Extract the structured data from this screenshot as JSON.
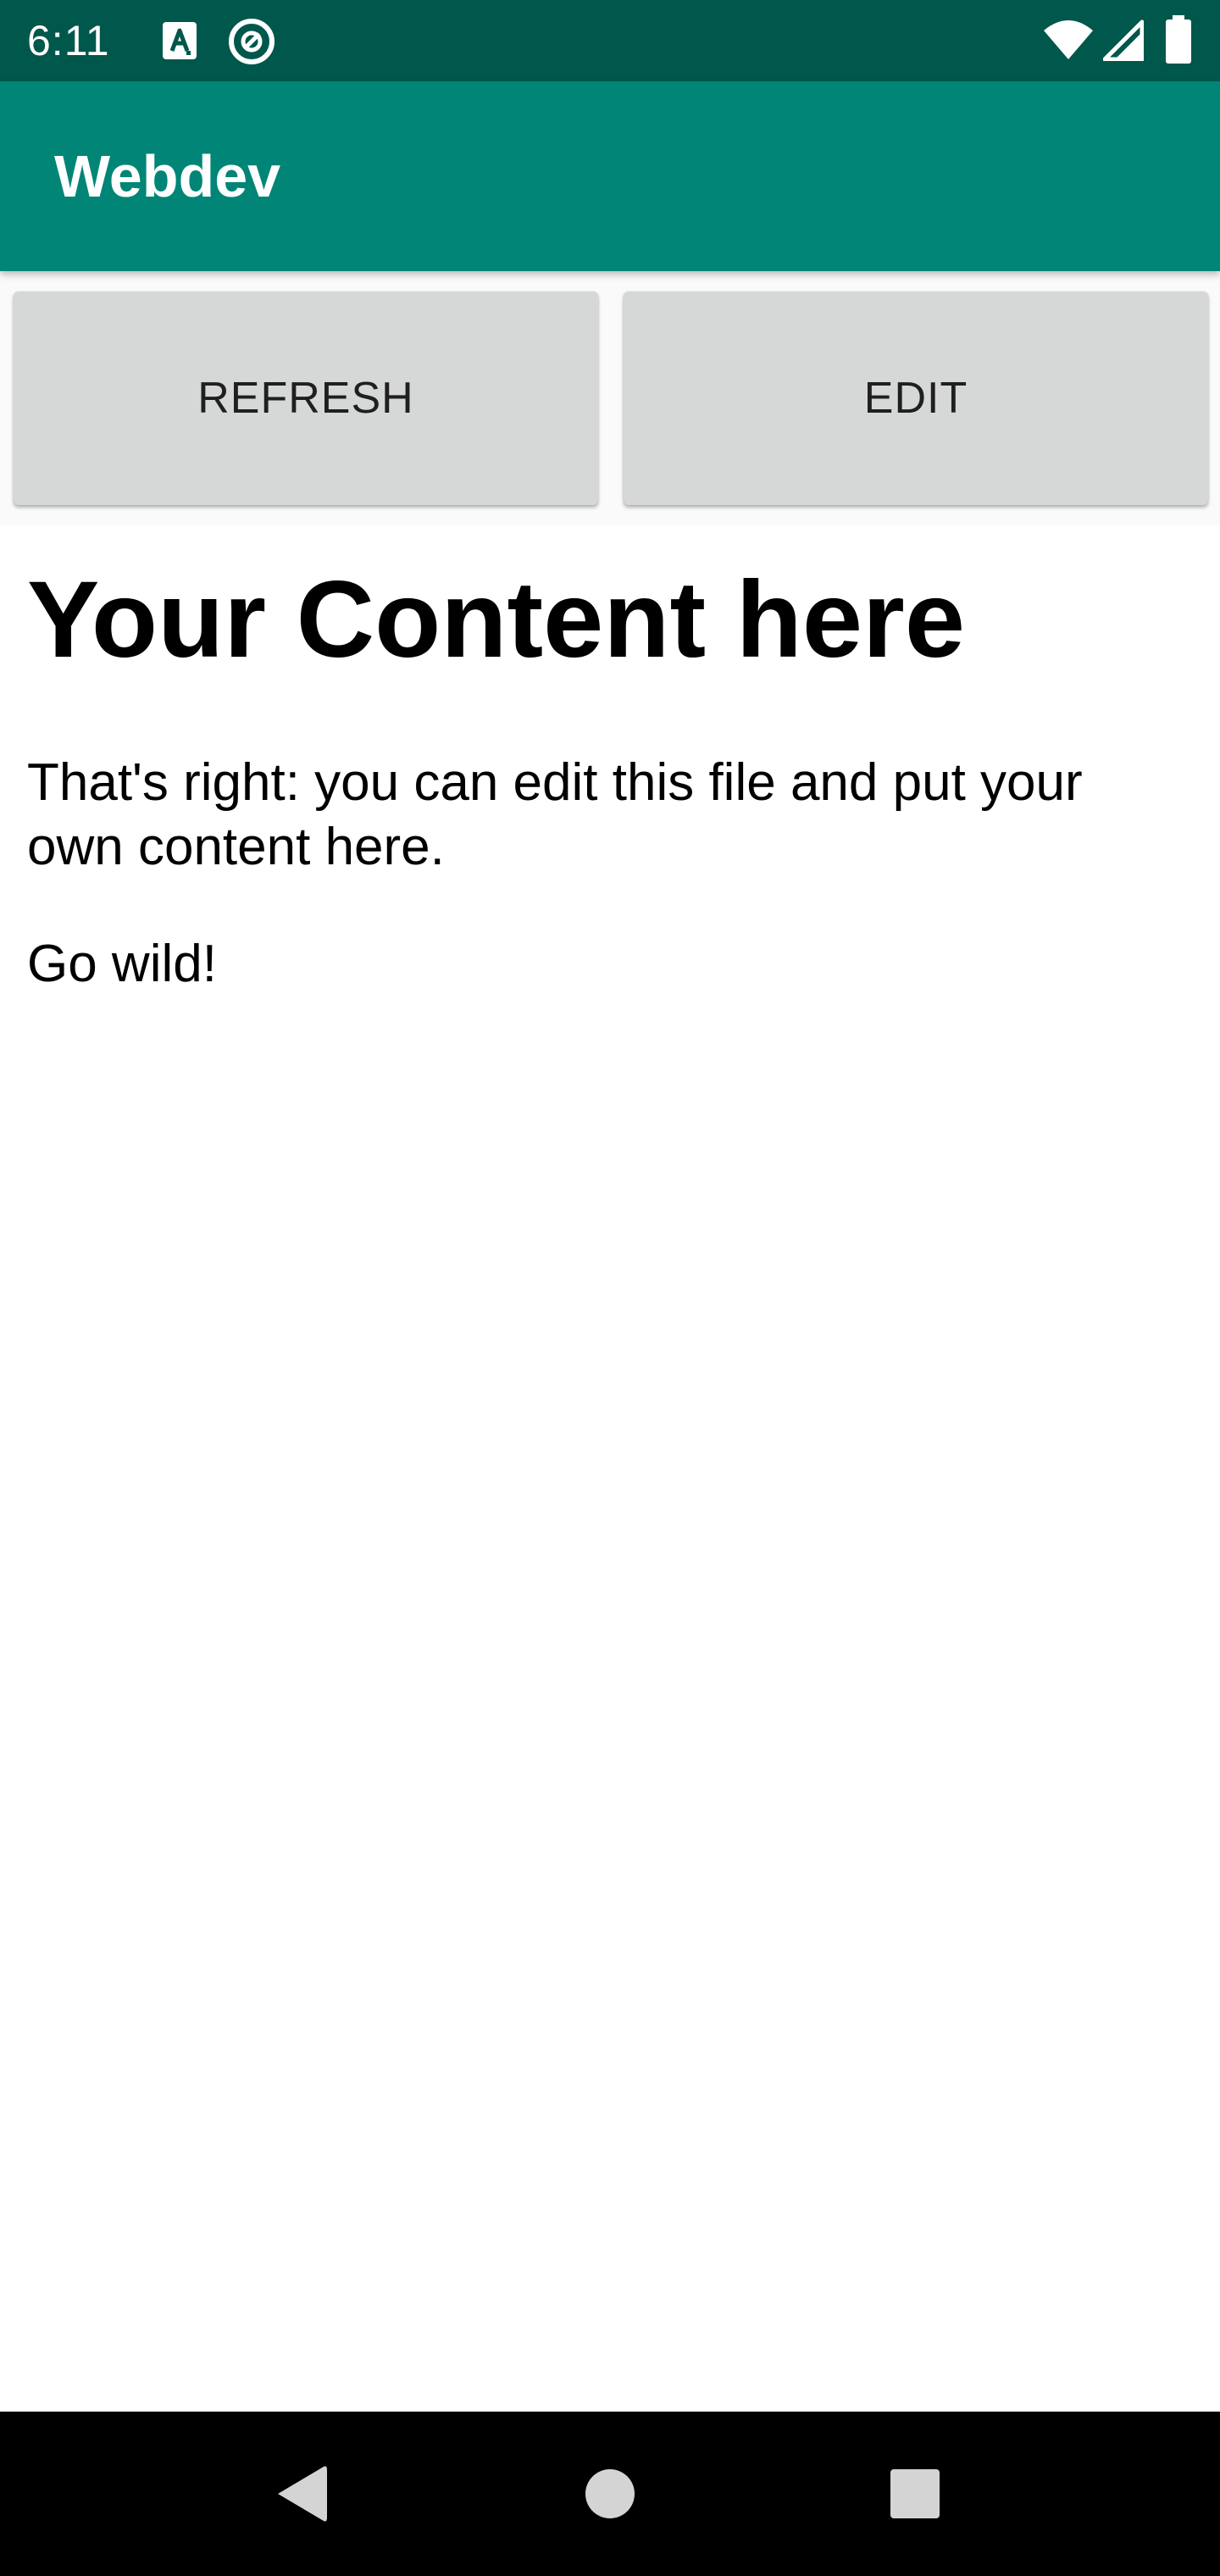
{
  "status_bar": {
    "time": "6:11",
    "icons": [
      "a-notification-icon",
      "at-sign-icon",
      "wifi-icon",
      "cellular-signal-icon",
      "battery-icon"
    ]
  },
  "app_bar": {
    "title": "Webdev"
  },
  "toolbar": {
    "refresh_label": "REFRESH",
    "edit_label": "EDIT"
  },
  "content": {
    "heading": "Your Content here",
    "paragraph_1": "That's right: you can edit this file and put your own content here.",
    "paragraph_2": "Go wild!"
  },
  "nav_bar": {
    "buttons": [
      "back-icon",
      "home-icon",
      "recents-icon"
    ]
  },
  "colors": {
    "status_bar": "#00574b",
    "app_bar": "#008577",
    "button_bg": "#d6d7d7",
    "nav_bar": "#000000"
  }
}
